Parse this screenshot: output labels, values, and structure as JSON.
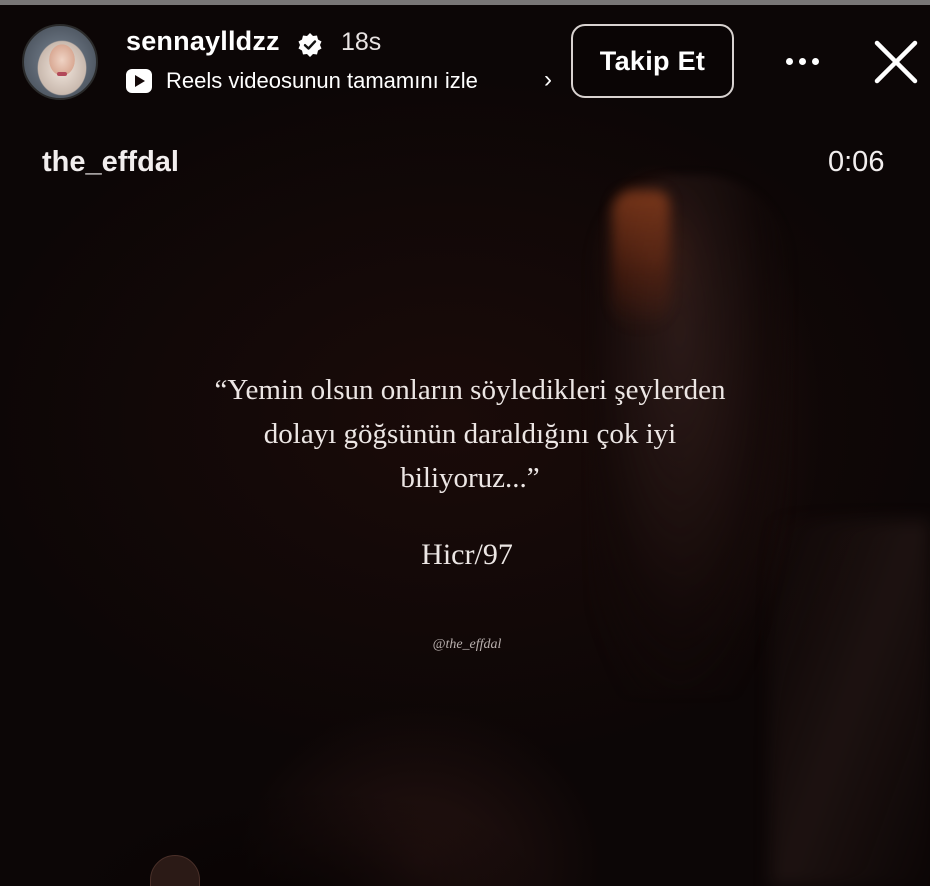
{
  "story": {
    "username": "sennaylldzz",
    "time_ago": "18s",
    "verified": true,
    "reels_link": "Reels videosunun tamamını izle",
    "reels_chevron": "›",
    "follow_label": "Takip Et",
    "progress": 1.0
  },
  "reel": {
    "creator": "the_effdal",
    "duration": "0:06",
    "quote_lines": [
      "“Yemin olsun onların söyledikleri şeylerden",
      "dolayı göğsünün daraldığını çok iyi",
      "biliyoruz...”"
    ],
    "reference": "Hicr/97",
    "watermark": "@the_effdal"
  },
  "icons": {
    "verified": "verified-badge-icon",
    "reels": "reels-play-icon",
    "more": "more-horizontal-icon",
    "close": "close-icon"
  },
  "colors": {
    "background": "#0c0606",
    "text": "#ffffff",
    "quote_text": "#ece6e4"
  }
}
